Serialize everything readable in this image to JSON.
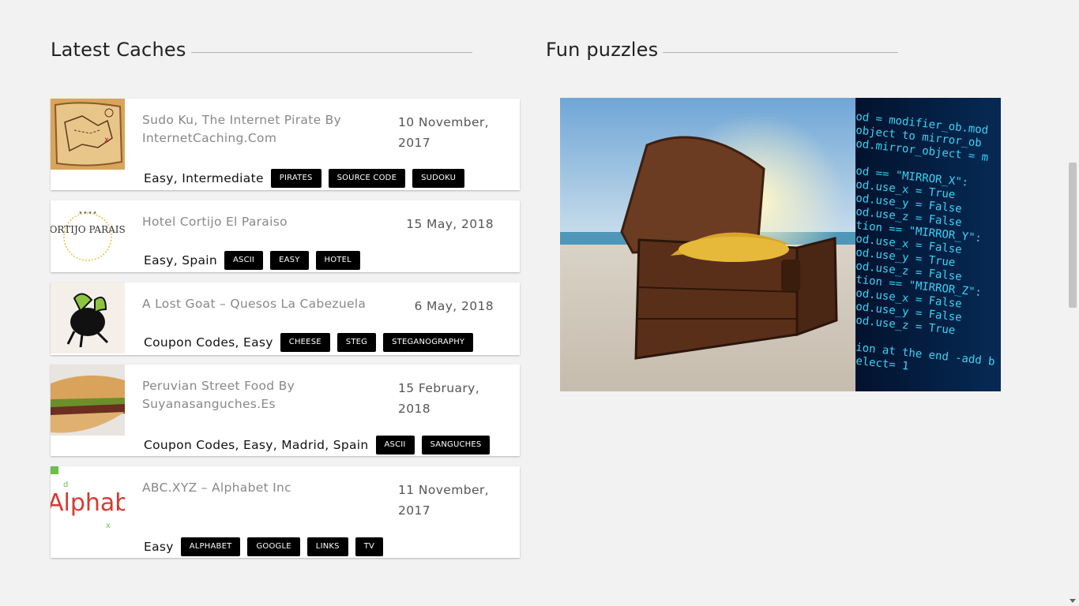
{
  "sections": {
    "latest_title": "Latest Caches",
    "fun_title": "Fun puzzles"
  },
  "caches": [
    {
      "title": "Sudo Ku, The Internet Pirate By InternetCaching.Com",
      "date": "10 November, 2017",
      "categories": "Easy, Intermediate",
      "tags": [
        "PIRATES",
        "SOURCE CODE",
        "SUDOKU"
      ],
      "thumb_icon": "treasure-map-icon"
    },
    {
      "title": "Hotel Cortijo El Paraiso",
      "date": "15 May, 2018",
      "categories": "Easy, Spain",
      "tags": [
        "ASCII",
        "EASY",
        "HOTEL"
      ],
      "thumb_icon": "hotel-logo-icon",
      "thumb_text": "CORTIJO PARAISO"
    },
    {
      "title": "A Lost Goat – Quesos La Cabezuela",
      "date": "6 May, 2018",
      "categories": "Coupon Codes, Easy",
      "tags": [
        "CHEESE",
        "STEG",
        "STEGANOGRAPHY"
      ],
      "thumb_icon": "goat-logo-icon"
    },
    {
      "title": "Peruvian Street Food By Suyanasanguches.Es",
      "date": "15 February, 2018",
      "categories": "Coupon Codes, Easy, Madrid, Spain",
      "tags": [
        "ASCII",
        "SANGUCHES"
      ],
      "thumb_icon": "sandwich-icon"
    },
    {
      "title": "ABC.XYZ – Alphabet Inc",
      "date": "11 November, 2017",
      "categories": "Easy",
      "tags": [
        "ALPHABET",
        "GOOGLE",
        "LINKS",
        "TV"
      ],
      "thumb_icon": "alphabet-logo-icon",
      "thumb_text": "Alphabe"
    }
  ],
  "puzzle_image": {
    "icon": "treasure-chest-image",
    "code_lines": [
      "od = modifier_ob.mod",
      " object to mirror_ob",
      "od.mirror_object = m",
      "",
      "od == \"MIRROR_X\":",
      "od.use_x = True",
      "od.use_y = False",
      "od.use_z = False",
      "tion == \"MIRROR_Y\":",
      "od.use_x = False",
      "od.use_y = True",
      "od.use_z = False",
      "tion == \"MIRROR_Z\":",
      "od.use_x = False",
      "od.use_y = False",
      "od.use_z = True",
      "",
      "ion at the end -add b",
      "elect= 1"
    ]
  },
  "colors": {
    "background": "#f2f2f2",
    "tag_bg": "#000000",
    "title_gray": "#888888"
  }
}
